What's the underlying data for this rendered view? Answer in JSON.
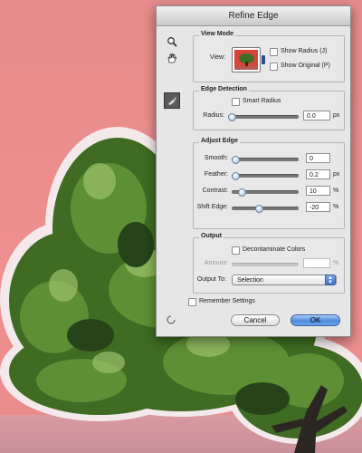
{
  "dialog": {
    "title": "Refine Edge"
  },
  "tools": {
    "zoom_icon": "magnifier-icon",
    "hand_icon": "hand-icon",
    "refine_radius_icon": "refine-radius-brush-icon"
  },
  "view_mode": {
    "title": "View Mode",
    "view_label": "View:",
    "show_radius": "Show Radius (J)",
    "show_original": "Show Original (P)",
    "show_radius_checked": false,
    "show_original_checked": false
  },
  "edge_detection": {
    "title": "Edge Detection",
    "smart_radius": "Smart Radius",
    "smart_radius_checked": false,
    "radius_label": "Radius:",
    "radius_value": "0.0",
    "radius_unit": "px",
    "radius_fraction": 0.0
  },
  "adjust_edge": {
    "title": "Adjust Edge",
    "smooth_label": "Smooth:",
    "smooth_value": "0",
    "smooth_fraction": 0.0,
    "feather_label": "Feather:",
    "feather_value": "0.2",
    "feather_unit": "px",
    "feather_fraction": 0.0,
    "contrast_label": "Contrast:",
    "contrast_value": "10",
    "contrast_unit": "%",
    "contrast_fraction": 0.1,
    "shift_label": "Shift Edge:",
    "shift_value": "-20",
    "shift_unit": "%",
    "shift_fraction": 0.4
  },
  "output": {
    "title": "Output",
    "decontaminate": "Decontaminate Colors",
    "decontaminate_checked": false,
    "amount_label": "Amount:",
    "amount_value": "",
    "amount_unit": "%",
    "output_to_label": "Output To:",
    "output_to_value": "Selection"
  },
  "remember_settings": "Remember Settings",
  "buttons": {
    "cancel": "Cancel",
    "ok": "OK"
  },
  "colors": {
    "background_pink": "#ee8e8e",
    "ok_blue": "#4f8ce0",
    "foliage": "#3f6b22"
  }
}
